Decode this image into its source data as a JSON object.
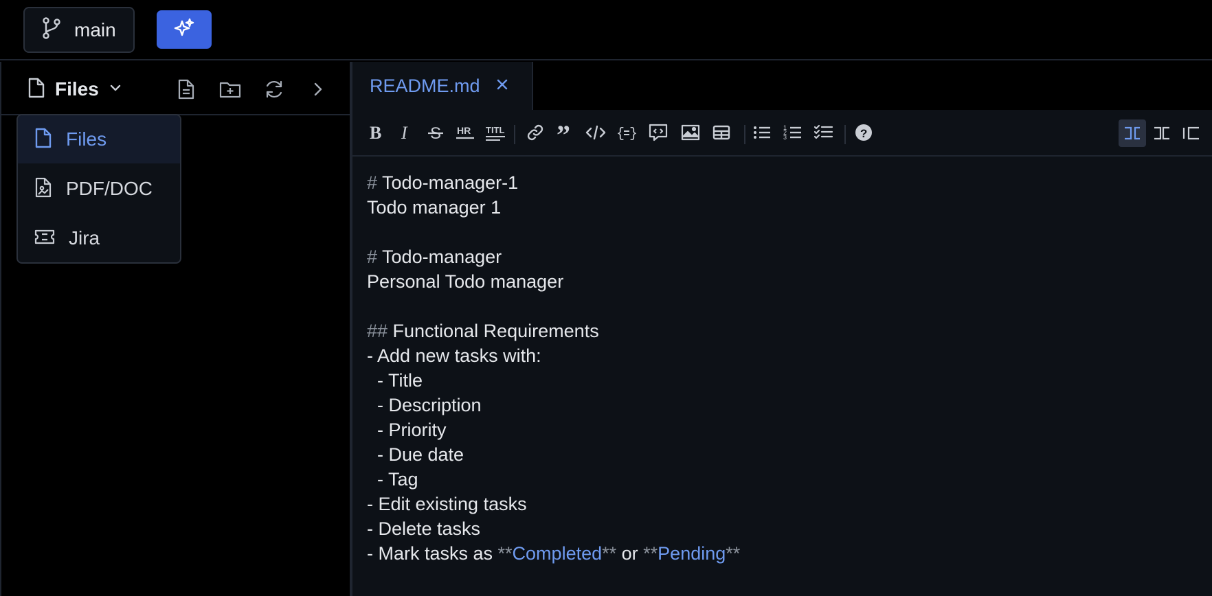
{
  "topbar": {
    "branch_label": "main"
  },
  "sidebar": {
    "selector_label": "Files",
    "dropdown": [
      {
        "label": "Files",
        "icon": "file-icon",
        "active": true
      },
      {
        "label": "PDF/DOC",
        "icon": "pdf-doc-icon",
        "active": false
      },
      {
        "label": "Jira",
        "icon": "ticket-icon",
        "active": false
      }
    ]
  },
  "editor": {
    "tab": {
      "label": "README.md"
    },
    "toolbar": [
      "bold",
      "italic",
      "strikethrough",
      "horizontal-rule",
      "title",
      "link",
      "quote",
      "code",
      "code-block",
      "comment",
      "image",
      "table",
      "unordered-list",
      "ordered-list",
      "task-list",
      "help"
    ],
    "lines": [
      {
        "mark": "# ",
        "text": "Todo-manager-1"
      },
      {
        "mark": "",
        "text": "Todo manager 1"
      },
      {
        "mark": "",
        "text": ""
      },
      {
        "mark": "# ",
        "text": "Todo-manager"
      },
      {
        "mark": "",
        "text": "Personal Todo manager"
      },
      {
        "mark": "",
        "text": ""
      },
      {
        "mark": "## ",
        "text": "Functional Requirements"
      },
      {
        "mark": "",
        "text": "- Add new tasks with:"
      },
      {
        "mark": "",
        "text": "  - Title"
      },
      {
        "mark": "",
        "text": "  - Description"
      },
      {
        "mark": "",
        "text": "  - Priority"
      },
      {
        "mark": "",
        "text": "  - Due date"
      },
      {
        "mark": "",
        "text": "  - Tag"
      },
      {
        "mark": "",
        "text": "- Edit existing tasks"
      },
      {
        "mark": "",
        "text": "- Delete tasks"
      }
    ],
    "last_line": {
      "prefix": "- Mark tasks as ",
      "mark1": "**",
      "strong1": "Completed",
      "mark2": "**",
      "middle": " or ",
      "mark3": "**",
      "strong2": "Pending",
      "mark4": "**"
    }
  },
  "colors": {
    "accent": "#3b63e0",
    "link": "#6f9bf0",
    "background": "#0d1117"
  }
}
